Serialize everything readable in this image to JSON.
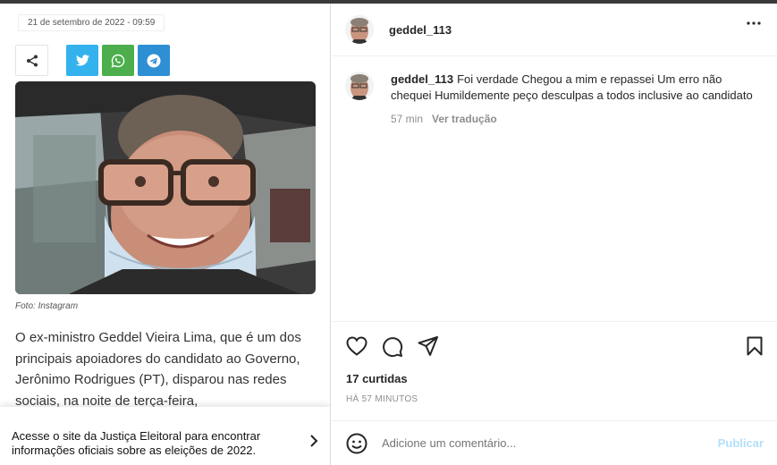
{
  "article": {
    "date": "21 de setembro de 2022 - 09:59",
    "share_icons": [
      "share-icon",
      "twitter-icon",
      "whatsapp-icon",
      "telegram-icon"
    ],
    "photo_caption": "Foto: Instagram",
    "body_text": "O ex-ministro Geddel Vieira Lima, que é um dos principais apoiadores do candidato ao Governo, Jerônimo Rodrigues (PT), disparou nas redes sociais, na noite de terça-feira,"
  },
  "banner": {
    "text": "Acesse o site da Justiça Eleitoral para encontrar informações oficiais sobre as eleições de 2022."
  },
  "post": {
    "username": "geddel_113",
    "comment_username": "geddel_113",
    "comment_text": "Foi verdade Chegou a mim e repassei Um erro não chequei Humildemente peço desculpas a todos inclusive ao candidato",
    "comment_time": "57 min",
    "translate_label": "Ver tradução",
    "likes": "17 curtidas",
    "time_ago": "HÁ 57 MINUTOS",
    "comment_placeholder": "Adicione um comentário...",
    "publish_label": "Publicar"
  },
  "colors": {
    "twitter": "#33b2ee",
    "whatsapp": "#4cae4c",
    "telegram": "#2e8fd4",
    "publish_disabled": "#b2dffc"
  }
}
